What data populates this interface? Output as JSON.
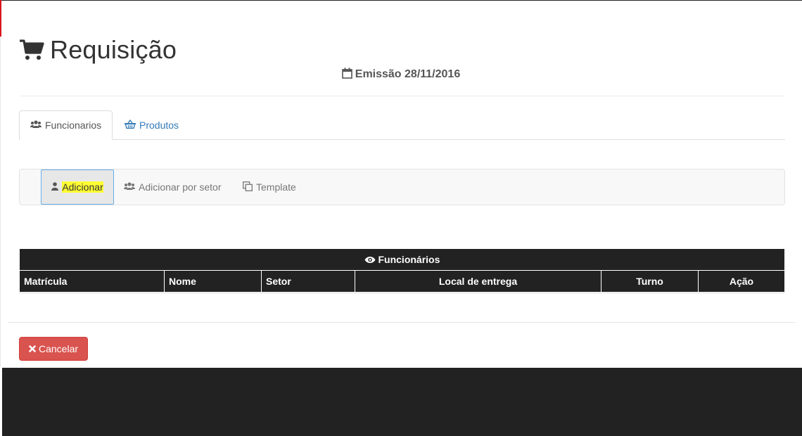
{
  "page": {
    "title": "Requisição",
    "emission_label": "Emissão 28/11/2016"
  },
  "tabs": [
    {
      "label": "Funcionarios",
      "icon": "users-icon",
      "active": true
    },
    {
      "label": "Produtos",
      "icon": "basket-icon",
      "active": false
    }
  ],
  "toolbar": {
    "add_label": "Adicionar",
    "add_by_sector_label": "Adicionar por setor",
    "template_label": "Template"
  },
  "table": {
    "caption": "Funcionários",
    "columns": [
      "Matrícula",
      "Nome",
      "Setor",
      "Local de entrega",
      "Turno",
      "Ação"
    ],
    "rows": []
  },
  "actions": {
    "cancel_label": "Cancelar"
  },
  "colors": {
    "link": "#337ab7",
    "danger": "#d9534f",
    "header_dark": "#222222",
    "highlight": "#ffff33"
  }
}
